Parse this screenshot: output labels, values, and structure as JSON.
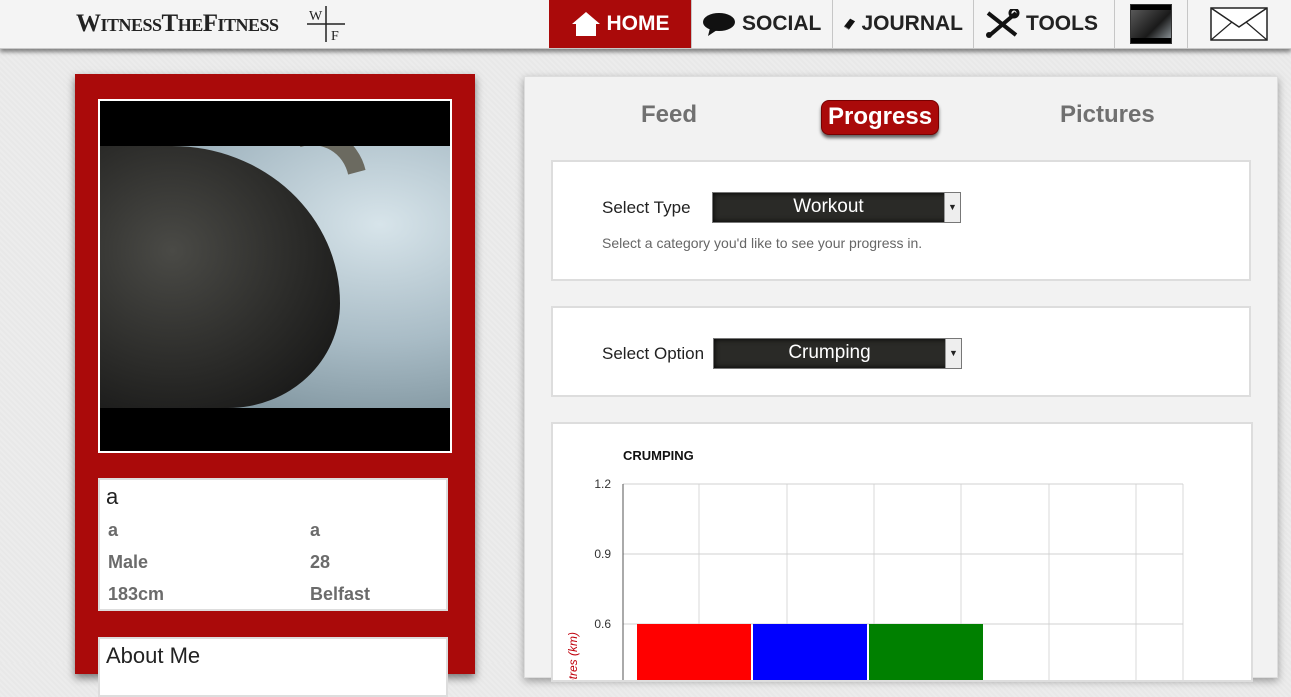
{
  "header": {
    "logo_text": "WitnessTheFitness",
    "logo_mark": [
      "W",
      "F"
    ],
    "nav": {
      "home": "HOME",
      "social": "SOCIAL",
      "journal": "JOURNAL",
      "tools": "TOOLS"
    }
  },
  "profile": {
    "name": "a",
    "first": "a",
    "last": "a",
    "gender": "Male",
    "age": "28",
    "height": "183cm",
    "location": "Belfast",
    "about_title": "About Me"
  },
  "tabs": {
    "feed": "Feed",
    "progress": "Progress",
    "pictures": "Pictures"
  },
  "filters": {
    "type_label": "Select Type",
    "type_value": "Workout",
    "type_help": "Select a category you'd like to see your progress in.",
    "option_label": "Select Option",
    "option_value": "Crumping"
  },
  "colors": {
    "accent": "#aa0a0a",
    "bar_red": "#ff0000",
    "bar_blue": "#0000ff",
    "bar_green": "#008000"
  },
  "chart_data": {
    "type": "bar",
    "title": "CRUMPING",
    "ylabel": "Kilometres (km)",
    "xlabel": "",
    "ylim": [
      0,
      1.2
    ],
    "yticks": [
      "1.2",
      "0.9",
      "0.6"
    ],
    "categories": [
      "",
      "",
      ""
    ],
    "values": [
      0.6,
      0.6,
      0.6
    ],
    "bar_colors": [
      "#ff0000",
      "#0000ff",
      "#008000"
    ],
    "grid": true
  }
}
